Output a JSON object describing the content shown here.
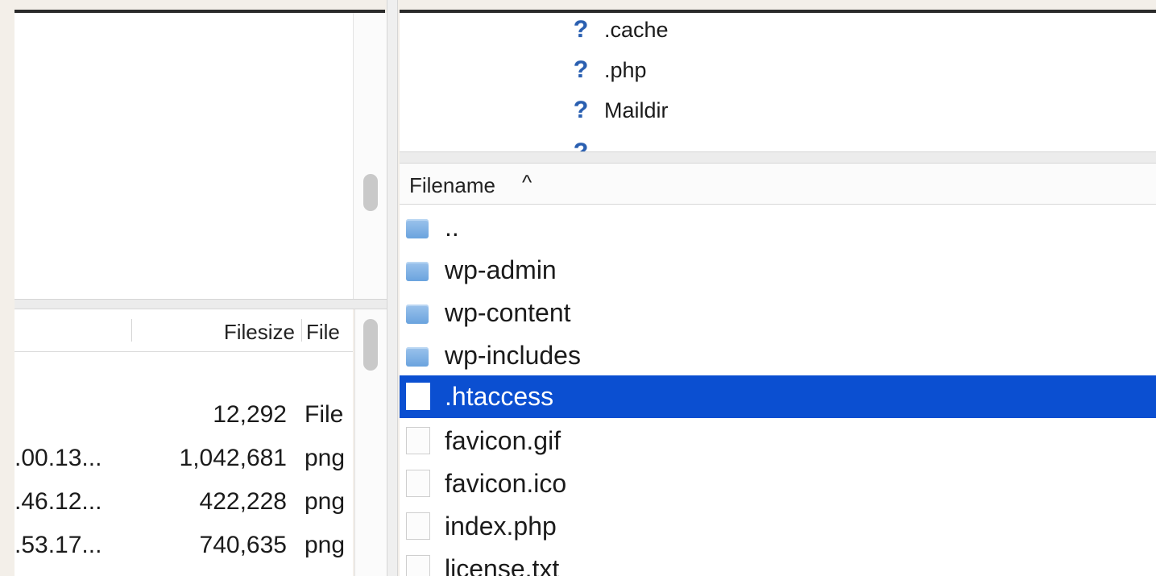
{
  "remote_tree": {
    "items": [
      {
        "icon": "unknown-icon",
        "label": ".cache"
      },
      {
        "icon": "unknown-icon",
        "label": ".php"
      },
      {
        "icon": "unknown-icon",
        "label": "Maildir"
      }
    ]
  },
  "local_list": {
    "columns": {
      "filesize": "Filesize",
      "filetype": "File"
    },
    "rows": [
      {
        "modified": "",
        "size": "12,292",
        "type": "File"
      },
      {
        "modified": ".00.13...",
        "size": "1,042,681",
        "type": "png"
      },
      {
        "modified": ".46.12...",
        "size": "422,228",
        "type": "png"
      },
      {
        "modified": ".53.17...",
        "size": "740,635",
        "type": "png"
      }
    ]
  },
  "remote_list": {
    "columns": {
      "filename": "Filename",
      "sort_indicator": "^"
    },
    "rows": [
      {
        "icon": "folder-icon",
        "name": ".."
      },
      {
        "icon": "folder-icon",
        "name": "wp-admin"
      },
      {
        "icon": "folder-icon",
        "name": "wp-content"
      },
      {
        "icon": "folder-icon",
        "name": "wp-includes"
      },
      {
        "icon": "file-icon",
        "name": ".htaccess",
        "selected": true
      },
      {
        "icon": "file-icon",
        "name": "favicon.gif"
      },
      {
        "icon": "file-icon",
        "name": "favicon.ico"
      },
      {
        "icon": "file-icon",
        "name": "index.php"
      },
      {
        "icon": "file-icon",
        "name": "license.txt"
      }
    ]
  },
  "colors": {
    "selection": "#0b4fd1",
    "background": "#f3efe9"
  }
}
